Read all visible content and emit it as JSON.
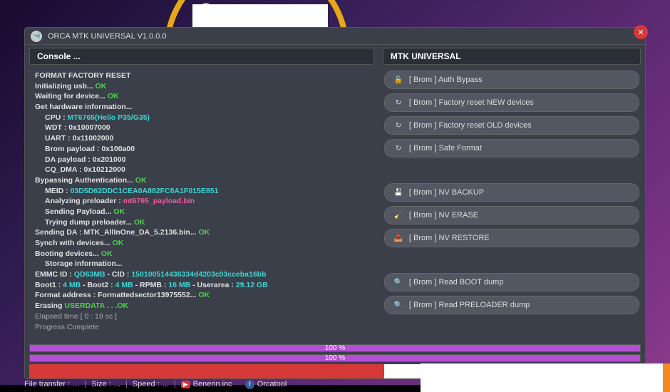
{
  "window": {
    "title": "ORCA MTK UNIVERSAL V1.0.0.0"
  },
  "panels": {
    "console_header": "Console ...",
    "actions_header": "MTK UNIVERSAL"
  },
  "console": {
    "lines": [
      {
        "cls": "c-white",
        "text": "FORMAT FACTORY RESET"
      },
      {
        "cls": "",
        "html": [
          [
            "c-white",
            "Initializing usb... "
          ],
          [
            "c-green",
            "OK"
          ]
        ]
      },
      {
        "cls": "",
        "html": [
          [
            "c-white",
            "Waiting for device... "
          ],
          [
            "c-green",
            "OK"
          ]
        ]
      },
      {
        "cls": "c-white",
        "text": "Get hardware information..."
      },
      {
        "cls": "indent1",
        "html": [
          [
            "c-white",
            "CPU : "
          ],
          [
            "c-cyan",
            "MT6765(Helio P35/G35)"
          ]
        ]
      },
      {
        "cls": "indent1 c-white",
        "text": "WDT : 0x10007000"
      },
      {
        "cls": "indent1 c-white",
        "text": "UART : 0x11002000"
      },
      {
        "cls": "indent1 c-white",
        "text": "Brom payload : 0x100a00"
      },
      {
        "cls": "indent1 c-white",
        "text": "DA payload : 0x201000"
      },
      {
        "cls": "indent1 c-white",
        "text": "CQ_DMA : 0x10212000"
      },
      {
        "cls": "",
        "html": [
          [
            "c-white",
            "Bypassing Authentication... "
          ],
          [
            "c-green",
            "OK"
          ]
        ]
      },
      {
        "cls": "indent1",
        "html": [
          [
            "c-white",
            "MEID : "
          ],
          [
            "c-cyan",
            "03D5D62DDC1CEA0A882FC8A1F015E851"
          ]
        ]
      },
      {
        "cls": "indent1",
        "html": [
          [
            "c-white",
            "Analyzing preloader : "
          ],
          [
            "c-pink",
            "mt6765_payload.bin"
          ]
        ]
      },
      {
        "cls": "indent1",
        "html": [
          [
            "c-white",
            "Sending Payload...  "
          ],
          [
            "c-green",
            "OK"
          ]
        ]
      },
      {
        "cls": "indent1",
        "html": [
          [
            "c-white",
            "Trying dump preloader... "
          ],
          [
            "c-green",
            "OK"
          ]
        ]
      },
      {
        "cls": "",
        "html": [
          [
            "c-white",
            "Sending DA : "
          ],
          [
            "c-white",
            "MTK_AllInOne_DA_5.2136.bin... "
          ],
          [
            "c-green",
            "OK"
          ]
        ]
      },
      {
        "cls": "",
        "html": [
          [
            "c-white",
            "Synch with devices... "
          ],
          [
            "c-green",
            "OK"
          ]
        ]
      },
      {
        "cls": "",
        "html": [
          [
            "c-white",
            "Booting devices... "
          ],
          [
            "c-green",
            "OK"
          ]
        ]
      },
      {
        "cls": "indent1 c-white",
        "text": "Storage information..."
      },
      {
        "cls": "",
        "html": [
          [
            "c-white",
            "EMMC ID : "
          ],
          [
            "c-cyan",
            "QD63MB"
          ],
          [
            "c-white",
            " - CID : "
          ],
          [
            "c-cyan",
            "150100514436334d4203c03cceba16bb"
          ]
        ]
      },
      {
        "cls": "",
        "html": [
          [
            "c-white",
            "Boot1 : "
          ],
          [
            "c-cyan",
            "4 MB"
          ],
          [
            "c-white",
            " - Boot2 : "
          ],
          [
            "c-cyan",
            "4 MB"
          ],
          [
            "c-white",
            " - RPMB : "
          ],
          [
            "c-cyan",
            "16 MB"
          ],
          [
            "c-white",
            " - Userarea : "
          ],
          [
            "c-cyan",
            "29.12 GB"
          ]
        ]
      },
      {
        "cls": "",
        "text": " "
      },
      {
        "cls": "",
        "html": [
          [
            "c-white",
            "Format address : "
          ],
          [
            "c-white",
            "Formattedsector13975552... "
          ],
          [
            "c-green",
            "OK"
          ]
        ]
      },
      {
        "cls": "",
        "html": [
          [
            "c-white",
            "Erasing "
          ],
          [
            "c-green",
            "USERDATA . . .OK"
          ]
        ]
      },
      {
        "cls": "",
        "text": " "
      },
      {
        "cls": "c-gray",
        "text": "Elapsed time [ 0 : 19 sc ]"
      },
      {
        "cls": "c-gray",
        "text": "Progress Complete"
      }
    ]
  },
  "actions": [
    {
      "icon": "🔓",
      "label": "[ Brom ] Auth Bypass"
    },
    {
      "icon": "↻",
      "label": "[ Brom ] Factory reset NEW devices"
    },
    {
      "icon": "↻",
      "label": "[ Brom ] Factory reset OLD devices"
    },
    {
      "icon": "↻",
      "label": "[ Brom ] Safe Format"
    },
    {
      "gap": true
    },
    {
      "icon": "💾",
      "label": "[ Brom ] NV BACKUP"
    },
    {
      "icon": "🧹",
      "label": "[ Brom ] NV ERASE"
    },
    {
      "icon": "📥",
      "label": "[ Brom ] NV RESTORE"
    },
    {
      "gap": true
    },
    {
      "icon": "🔍",
      "label": "[ Brom ] Read BOOT dump"
    },
    {
      "icon": "🔍",
      "label": "[ Brom ] Read PRELOADER dump"
    }
  ],
  "progress": {
    "bar1": {
      "percent": 100,
      "label": "100 %"
    },
    "bar2": {
      "percent": 100,
      "label": "100 %"
    }
  },
  "statusbar": {
    "file_transfer_label": "File transfer :",
    "file_transfer_value": "...",
    "size_label": "Size :",
    "size_value": "...",
    "speed_label": "Speed :",
    "speed_value": "...",
    "youtube": "Benerin.inc",
    "facebook": "Orcatool"
  }
}
